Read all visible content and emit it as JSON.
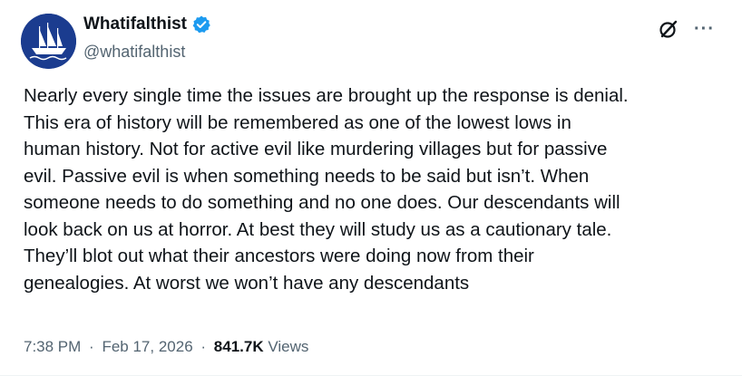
{
  "author": {
    "display_name": "Whatifalthist",
    "handle": "@whatifalthist",
    "verified": true,
    "avatar": "ship-logo"
  },
  "actions": {
    "grok_icon": "grok-icon",
    "more_icon": "more-dots-icon",
    "more_label": "···"
  },
  "tweet": {
    "text": "Nearly every single time the issues are brought up the response is denial.\nThis era of history will be remembered as one of the lowest lows in\nhuman history. Not for active evil like murdering villages but for passive\nevil. Passive evil is when something needs to be said but isn’t. When\nsomeone needs to do something and no one does. Our descendants will\nlook back on us at horror. At best they will study us as a cautionary tale.\nThey’ll blot out what their ancestors were doing now from their\ngenealogies. At worst we won’t have any descendants"
  },
  "meta": {
    "time": "7:38 PM",
    "date": "Feb 17, 2026",
    "separator": "·",
    "views_count": "841.7K",
    "views_label": "Views"
  },
  "colors": {
    "avatar_bg": "#1b3c8f",
    "verified_blue": "#1d9bf0",
    "text": "#0f1419",
    "muted": "#536471"
  }
}
